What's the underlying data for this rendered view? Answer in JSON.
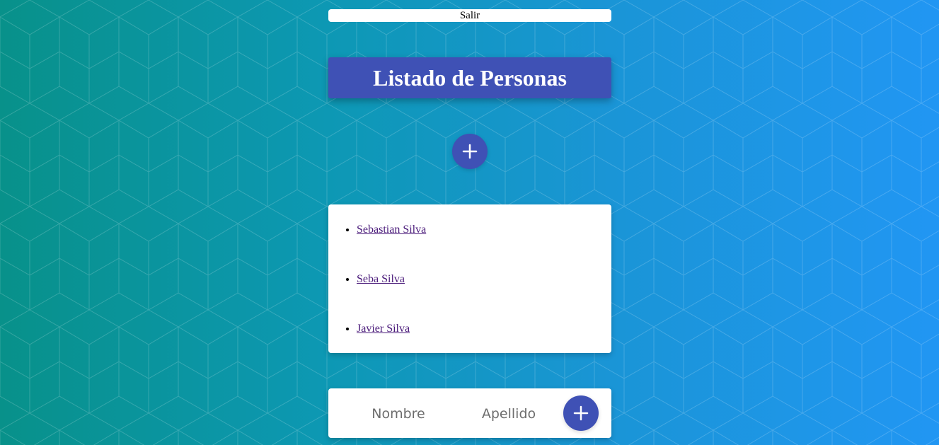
{
  "header": {
    "logout_label": "Salir",
    "title": "Listado de Personas"
  },
  "people": [
    {
      "name": "Sebastian Silva"
    },
    {
      "name": "Seba Silva"
    },
    {
      "name": "Javier Silva"
    }
  ],
  "form": {
    "nombre_placeholder": "Nombre",
    "apellido_placeholder": "Apellido",
    "nombre_value": "",
    "apellido_value": ""
  },
  "icons": {
    "add_top": "plus-icon",
    "add_form": "plus-icon"
  },
  "colors": {
    "primary": "#3f51b5",
    "gradient_start": "#08918a",
    "gradient_end": "#2196f3",
    "link": "#4a1a7a"
  }
}
